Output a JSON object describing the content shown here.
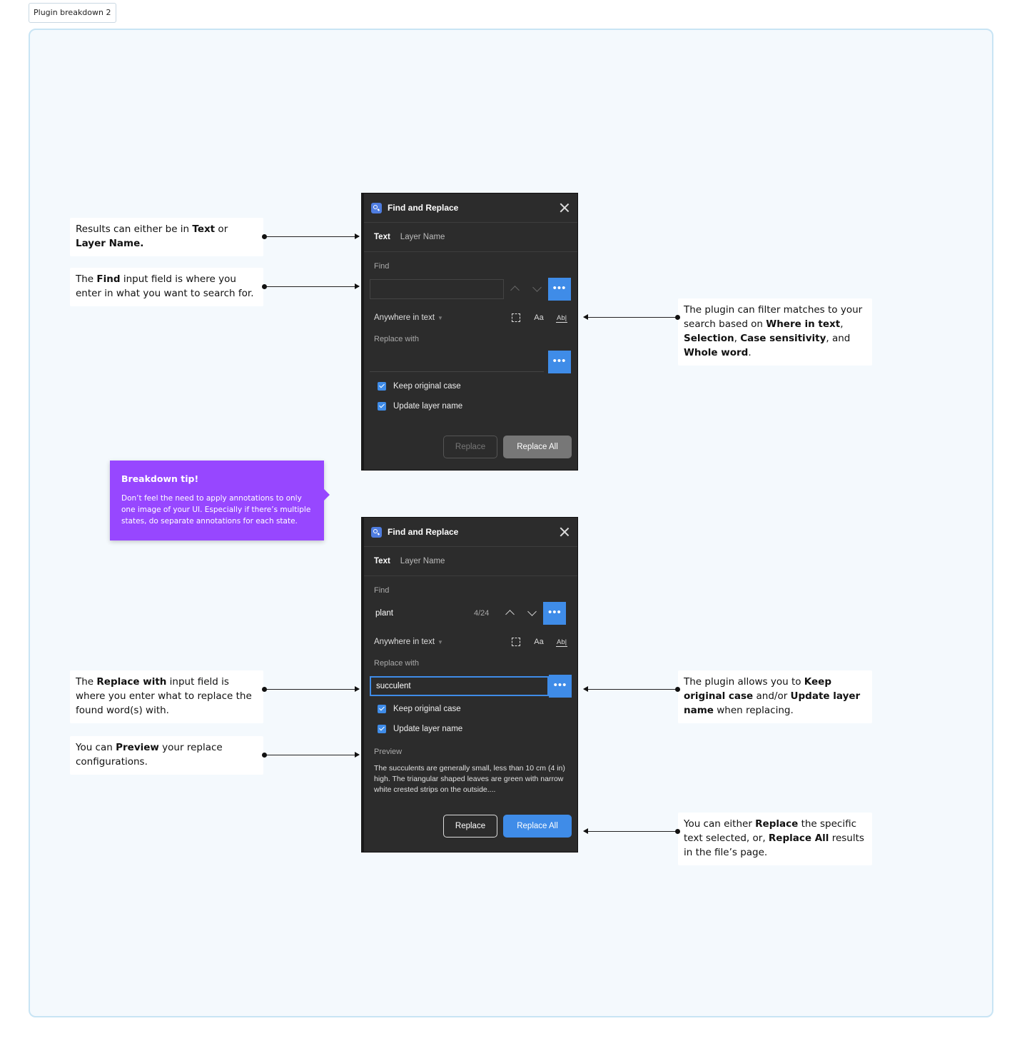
{
  "frame": {
    "label": "Plugin breakdown 2"
  },
  "notes": {
    "results": {
      "parts": [
        "Results can either be in ",
        "Text",
        " or ",
        "Layer Name."
      ]
    },
    "find": {
      "parts": [
        "The ",
        "Find",
        " input field is where you enter in what you want to search for."
      ]
    },
    "filter": {
      "parts": [
        "The plugin can filter matches to your search based on ",
        "Where in text",
        ", ",
        "Selection",
        ", ",
        "Case sensitivity",
        ", and ",
        "Whole word",
        "."
      ]
    },
    "replace_with": {
      "parts": [
        "The ",
        "Replace with",
        " input field is where you enter what to replace the found word(s) with."
      ]
    },
    "preview": {
      "parts": [
        "You can ",
        "Preview",
        " your replace configurations."
      ]
    },
    "keep_case": {
      "parts": [
        "The plugin allows you to ",
        "Keep original case",
        " and/or ",
        "Update layer name",
        " when replacing."
      ]
    },
    "replace_all": {
      "parts": [
        "You can either ",
        "Replace",
        " the specific text selected, or, ",
        "Replace All",
        " results in the file’s page."
      ]
    }
  },
  "tip": {
    "title": "Breakdown tip!",
    "body": "Don’t feel the need to apply annotations to only one image of your UI. Especially if there’s multiple states, do separate annotations for each state."
  },
  "panel1": {
    "title": "Find and Replace",
    "tabs": [
      "Text",
      "Layer Name"
    ],
    "find_label": "Find",
    "find_value": "",
    "more_icon": "more-horizontal-icon",
    "where_label": "Anywhere in text",
    "case_label": "Aa",
    "whole_word_label": "Ab|",
    "replace_label": "Replace with",
    "replace_value": "",
    "keep_case_label": "Keep original case",
    "update_layer_label": "Update layer name",
    "replace_button": "Replace",
    "replace_all_button": "Replace All"
  },
  "panel2": {
    "title": "Find and Replace",
    "tabs": [
      "Text",
      "Layer Name"
    ],
    "find_label": "Find",
    "find_value": "plant",
    "match_count": "4/24",
    "where_label": "Anywhere in text",
    "case_label": "Aa",
    "whole_word_label": "Ab|",
    "replace_label": "Replace with",
    "replace_value": "succulent",
    "keep_case_label": "Keep original case",
    "update_layer_label": "Update layer name",
    "preview_label": "Preview",
    "preview_text": "The succulents are generally small, less than 10 cm (4 in) high. The triangular shaped leaves are green with narrow white crested strips on the outside....",
    "replace_button": "Replace",
    "replace_all_button": "Replace All"
  },
  "colors": {
    "accent": "#3f8ce8",
    "tip": "#9747ff",
    "panel_bg": "#2c2c2c",
    "canvas_bg": "#f4f9fd",
    "canvas_border": "#c8e4f4"
  }
}
